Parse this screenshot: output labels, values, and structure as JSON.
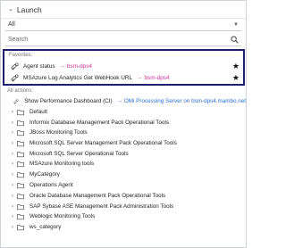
{
  "header": {
    "title": "Launch"
  },
  "scope_select": {
    "value": "All"
  },
  "search": {
    "placeholder": "Search"
  },
  "favorites": {
    "label": "Favorites:",
    "items": [
      {
        "name": "Agent status",
        "arrow": "→",
        "target": "bsm-dps4",
        "starred": true,
        "star": "★"
      },
      {
        "name": "MSAzure Log Analytics Get WebHook URL",
        "arrow": "→",
        "target": "bsm-dps4",
        "starred": true,
        "star": "★"
      }
    ]
  },
  "all_actions": {
    "label": "All actions:",
    "items": [
      {
        "name": "Show Performance Dashboard (CI)",
        "type": "action",
        "arrow": "→",
        "target": "OMi Processing Server on bsm-dps4.mambo.net"
      },
      {
        "name": "Default",
        "type": "folder",
        "expand": "›"
      },
      {
        "name": "Informix Database Management Pack Operational Tools",
        "type": "folder",
        "expand": "›"
      },
      {
        "name": "JBoss Monitoring Tools",
        "type": "folder",
        "expand": "›"
      },
      {
        "name": "Microsoft SQL Server Management Pack Operational Tools",
        "type": "folder",
        "expand": "›"
      },
      {
        "name": "Microsoft SQL Server Operational Tools",
        "type": "folder",
        "expand": "›"
      },
      {
        "name": "MSAzure Monitoring tools",
        "type": "folder",
        "expand": "›"
      },
      {
        "name": "MyCategory",
        "type": "folder",
        "expand": "›"
      },
      {
        "name": "Operations Agent",
        "type": "folder",
        "expand": "›"
      },
      {
        "name": "Oracle Database Management Pack Operational Tools",
        "type": "folder",
        "expand": "›"
      },
      {
        "name": "SAP Sybase ASE Management Pack Administration Tools",
        "type": "folder",
        "expand": "›"
      },
      {
        "name": "Weblogic Monitoring Tools",
        "type": "folder",
        "expand": "›"
      },
      {
        "name": "ws_category",
        "type": "folder",
        "expand": "›"
      }
    ]
  },
  "colors": {
    "highlight_border": "#1e1e6e",
    "favorite_link": "#d0309a",
    "action_link": "#2a6fd6"
  }
}
